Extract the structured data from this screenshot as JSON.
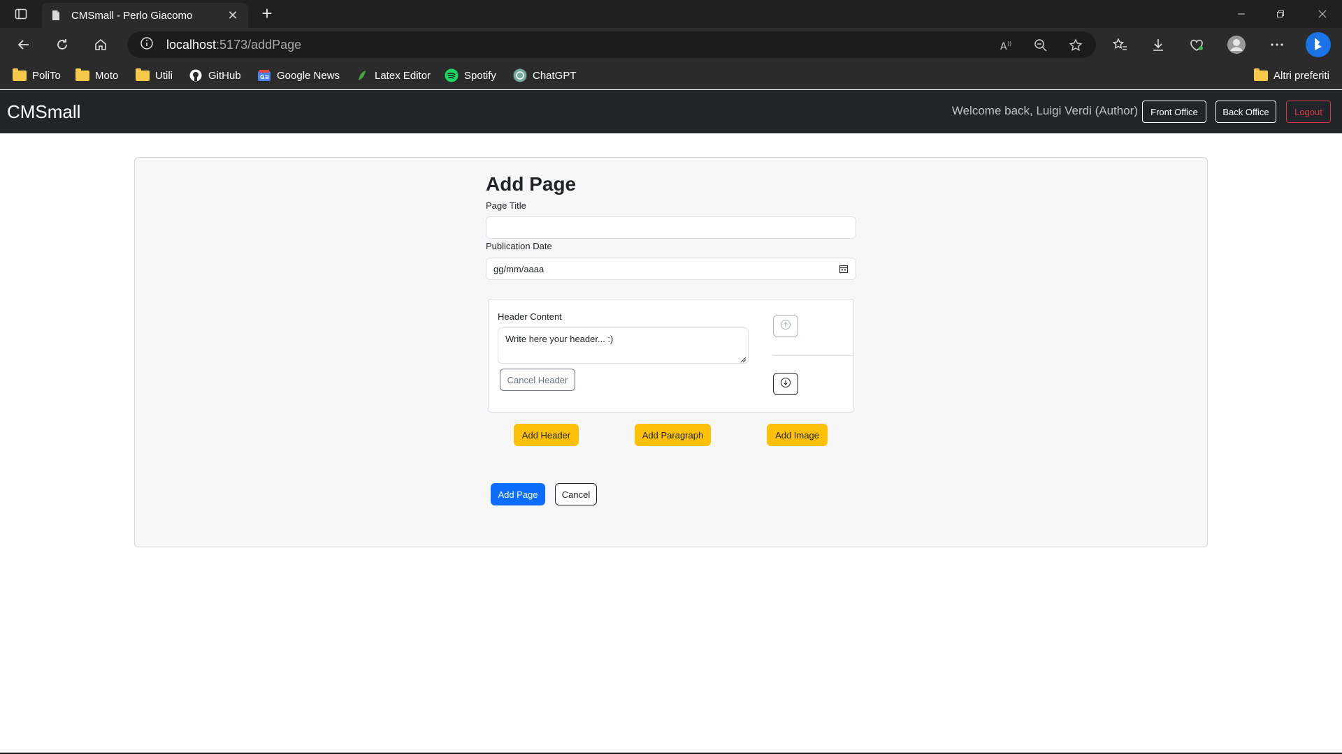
{
  "browser": {
    "tab_title": "CMSmall - Perlo Giacomo",
    "tab_close": "✕",
    "newtab": "+",
    "url_host": "localhost",
    "url_rest": ":5173/addPage",
    "bookmarks": [
      {
        "label": "PoliTo",
        "icon": "folder-icon"
      },
      {
        "label": "Moto",
        "icon": "folder-icon"
      },
      {
        "label": "Utili",
        "icon": "folder-icon"
      },
      {
        "label": "GitHub",
        "icon": "github-icon"
      },
      {
        "label": "Google News",
        "icon": "google-news-icon"
      },
      {
        "label": "Latex Editor",
        "icon": "latex-icon"
      },
      {
        "label": "Spotify",
        "icon": "spotify-icon"
      },
      {
        "label": "ChatGPT",
        "icon": "chatgpt-icon"
      }
    ],
    "other_favorites": "Altri preferiti"
  },
  "navbar": {
    "brand": "CMSmall",
    "welcome": "Welcome back, Luigi Verdi (Author)",
    "front_office": "Front Office",
    "back_office": "Back Office",
    "logout": "Logout"
  },
  "form": {
    "title": "Add Page",
    "page_title_label": "Page Title",
    "page_title_value": "",
    "publication_date_label": "Publication Date",
    "publication_date_value": "gg/mm/aaaa",
    "block": {
      "label": "Header Content",
      "placeholder": "Write here your header... :)",
      "cancel": "Cancel Header"
    },
    "add_header": "Add Header",
    "add_paragraph": "Add Paragraph",
    "add_image": "Add Image",
    "submit": "Add Page",
    "cancel": "Cancel"
  },
  "colors": {
    "navbar_bg": "#212529",
    "primary": "#0d6efd",
    "warning": "#ffc107",
    "danger": "#dc3545"
  }
}
